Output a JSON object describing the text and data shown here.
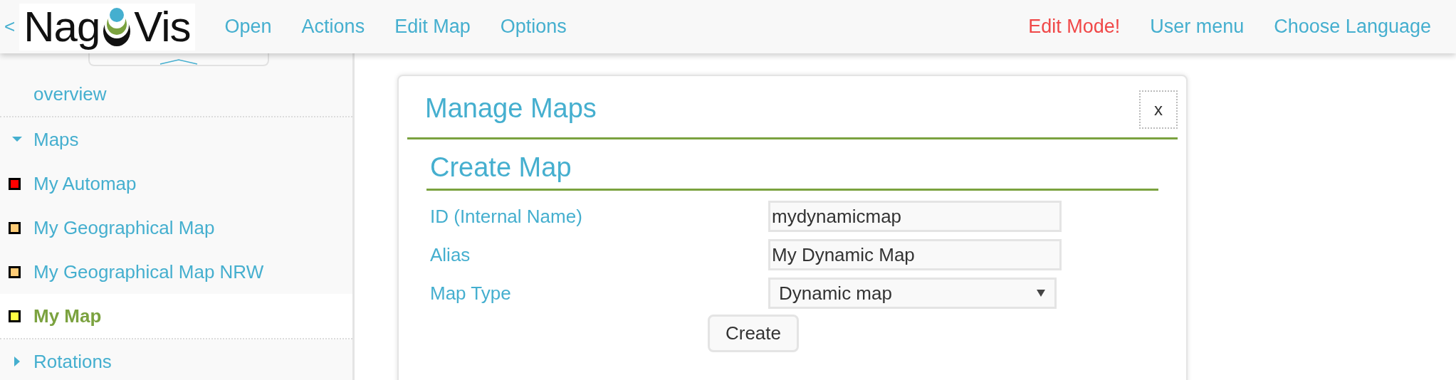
{
  "header": {
    "back": "<",
    "logo": {
      "left": "Nag",
      "right": "Vis"
    },
    "menu": [
      {
        "label": "Open"
      },
      {
        "label": "Actions"
      },
      {
        "label": "Edit Map"
      },
      {
        "label": "Options"
      }
    ],
    "right_menu": [
      {
        "label": "Edit Mode!",
        "kind": "alert"
      },
      {
        "label": "User menu",
        "kind": "link"
      },
      {
        "label": "Choose Language",
        "kind": "link"
      }
    ]
  },
  "sidebar": {
    "items": [
      {
        "kind": "link",
        "label": "overview"
      },
      {
        "kind": "section",
        "label": "Maps",
        "expanded": true,
        "children": [
          {
            "label": "My Automap",
            "color": "#ff0000",
            "selected": false
          },
          {
            "label": "My Geographical Map",
            "color": "#ffcc77",
            "selected": false
          },
          {
            "label": "My Geographical Map NRW",
            "color": "#ffcc77",
            "selected": false
          },
          {
            "label": "My Map",
            "color": "#ffff44",
            "selected": true
          }
        ]
      },
      {
        "kind": "section",
        "label": "Rotations",
        "expanded": false
      }
    ]
  },
  "dialog": {
    "title": "Manage Maps",
    "close": "x",
    "section": "Create Map",
    "fields": [
      {
        "kind": "text",
        "label": "ID (Internal Name)",
        "value": "mydynamicmap"
      },
      {
        "kind": "text",
        "label": "Alias",
        "value": "My Dynamic Map"
      },
      {
        "kind": "select",
        "label": "Map Type",
        "value": "Dynamic map"
      }
    ],
    "button": "Create"
  }
}
